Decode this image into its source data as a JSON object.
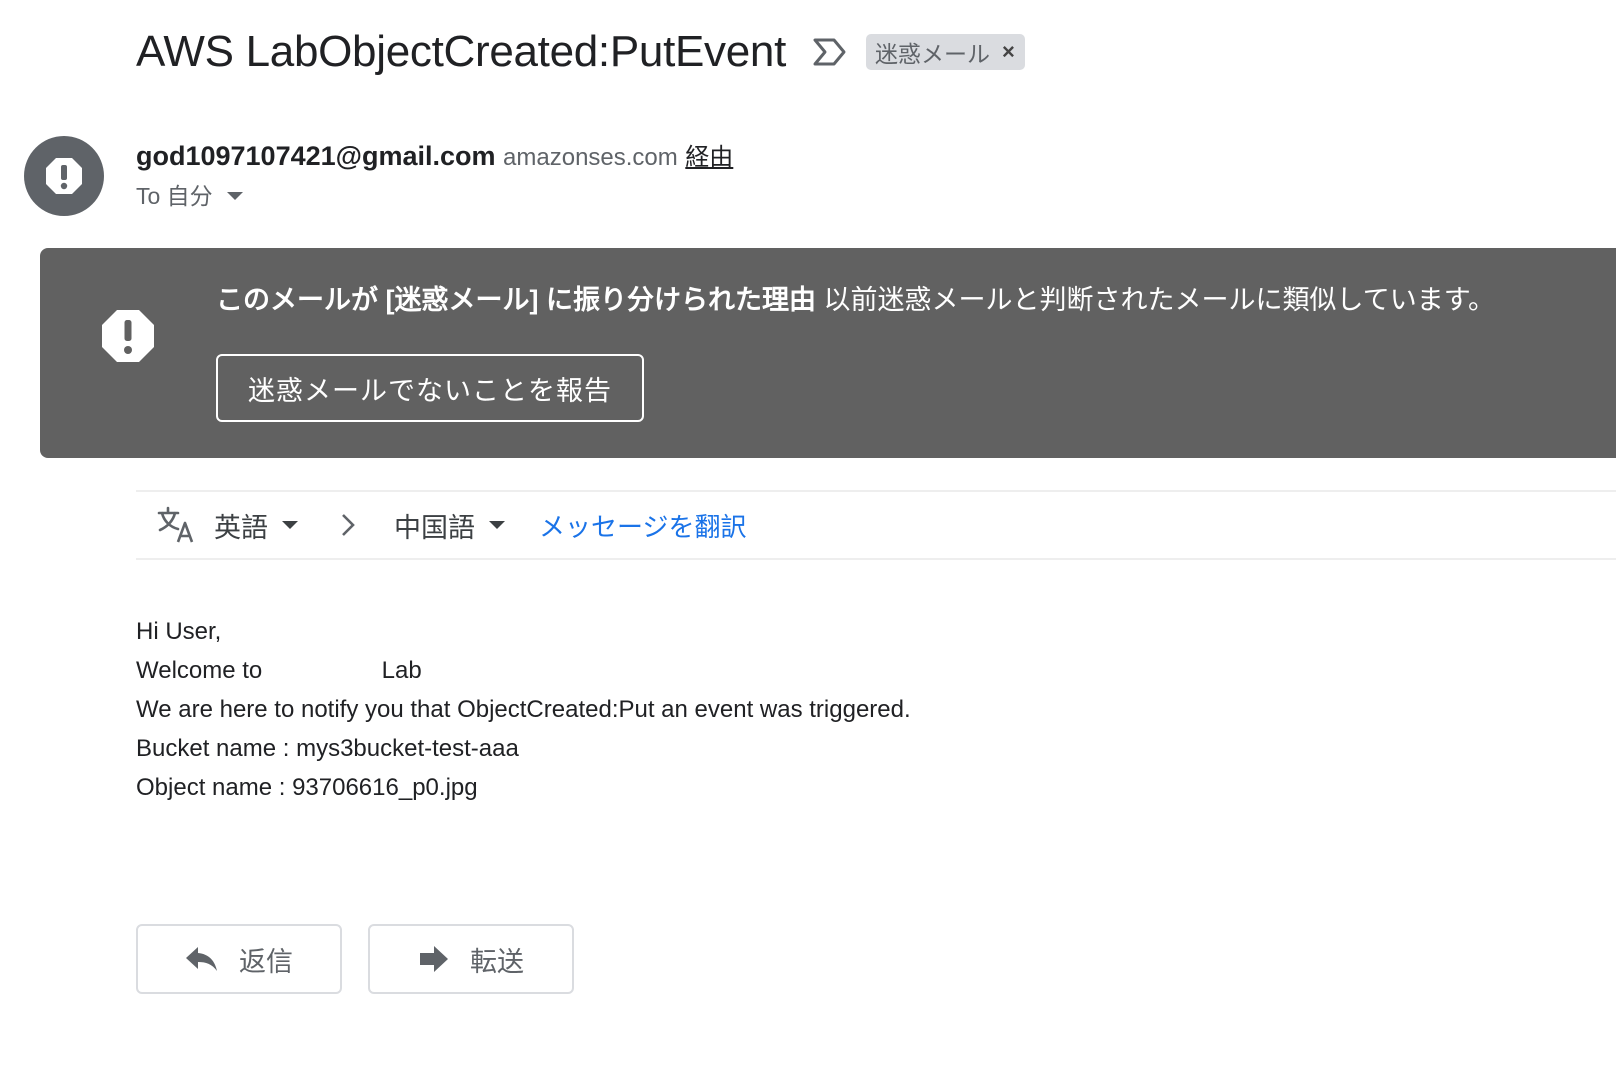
{
  "subject": "AWS LabObjectCreated:PutEvent",
  "label_chip": {
    "text": "迷惑メール",
    "remove_glyph": "×"
  },
  "sender": {
    "email": "god1097107421@gmail.com",
    "via_domain": "amazonses.com",
    "via_label": "経由",
    "to_label": "To 自分"
  },
  "spam_banner": {
    "reason_bold": "このメールが [迷惑メール] に振り分けられた理由",
    "reason_text": "以前迷惑メールと判断されたメールに類似しています。",
    "not_spam_button": "迷惑メールでないことを報告"
  },
  "translate_bar": {
    "source_lang": "英語",
    "target_lang": "中国語",
    "translate_link": "メッセージを翻訳"
  },
  "body": {
    "greeting": "Hi User,",
    "welcome_prefix": "Welcome to",
    "welcome_suffix": "Lab",
    "notice": "We are here to notify you that ObjectCreated:Put an event was triggered.",
    "bucket": "Bucket name : mys3bucket-test-aaa",
    "object": "Object name : 93706616_p0.jpg"
  },
  "actions": {
    "reply": "返信",
    "forward": "転送"
  },
  "colors": {
    "banner_bg": "#616161",
    "link": "#1a73e8",
    "chip_bg": "#dadce0",
    "avatar_bg": "#5f6368"
  },
  "icons": [
    "importance-marker-icon",
    "close-icon",
    "warning-icon",
    "translate-icon",
    "chevron-right-icon",
    "reply-icon",
    "forward-icon"
  ]
}
